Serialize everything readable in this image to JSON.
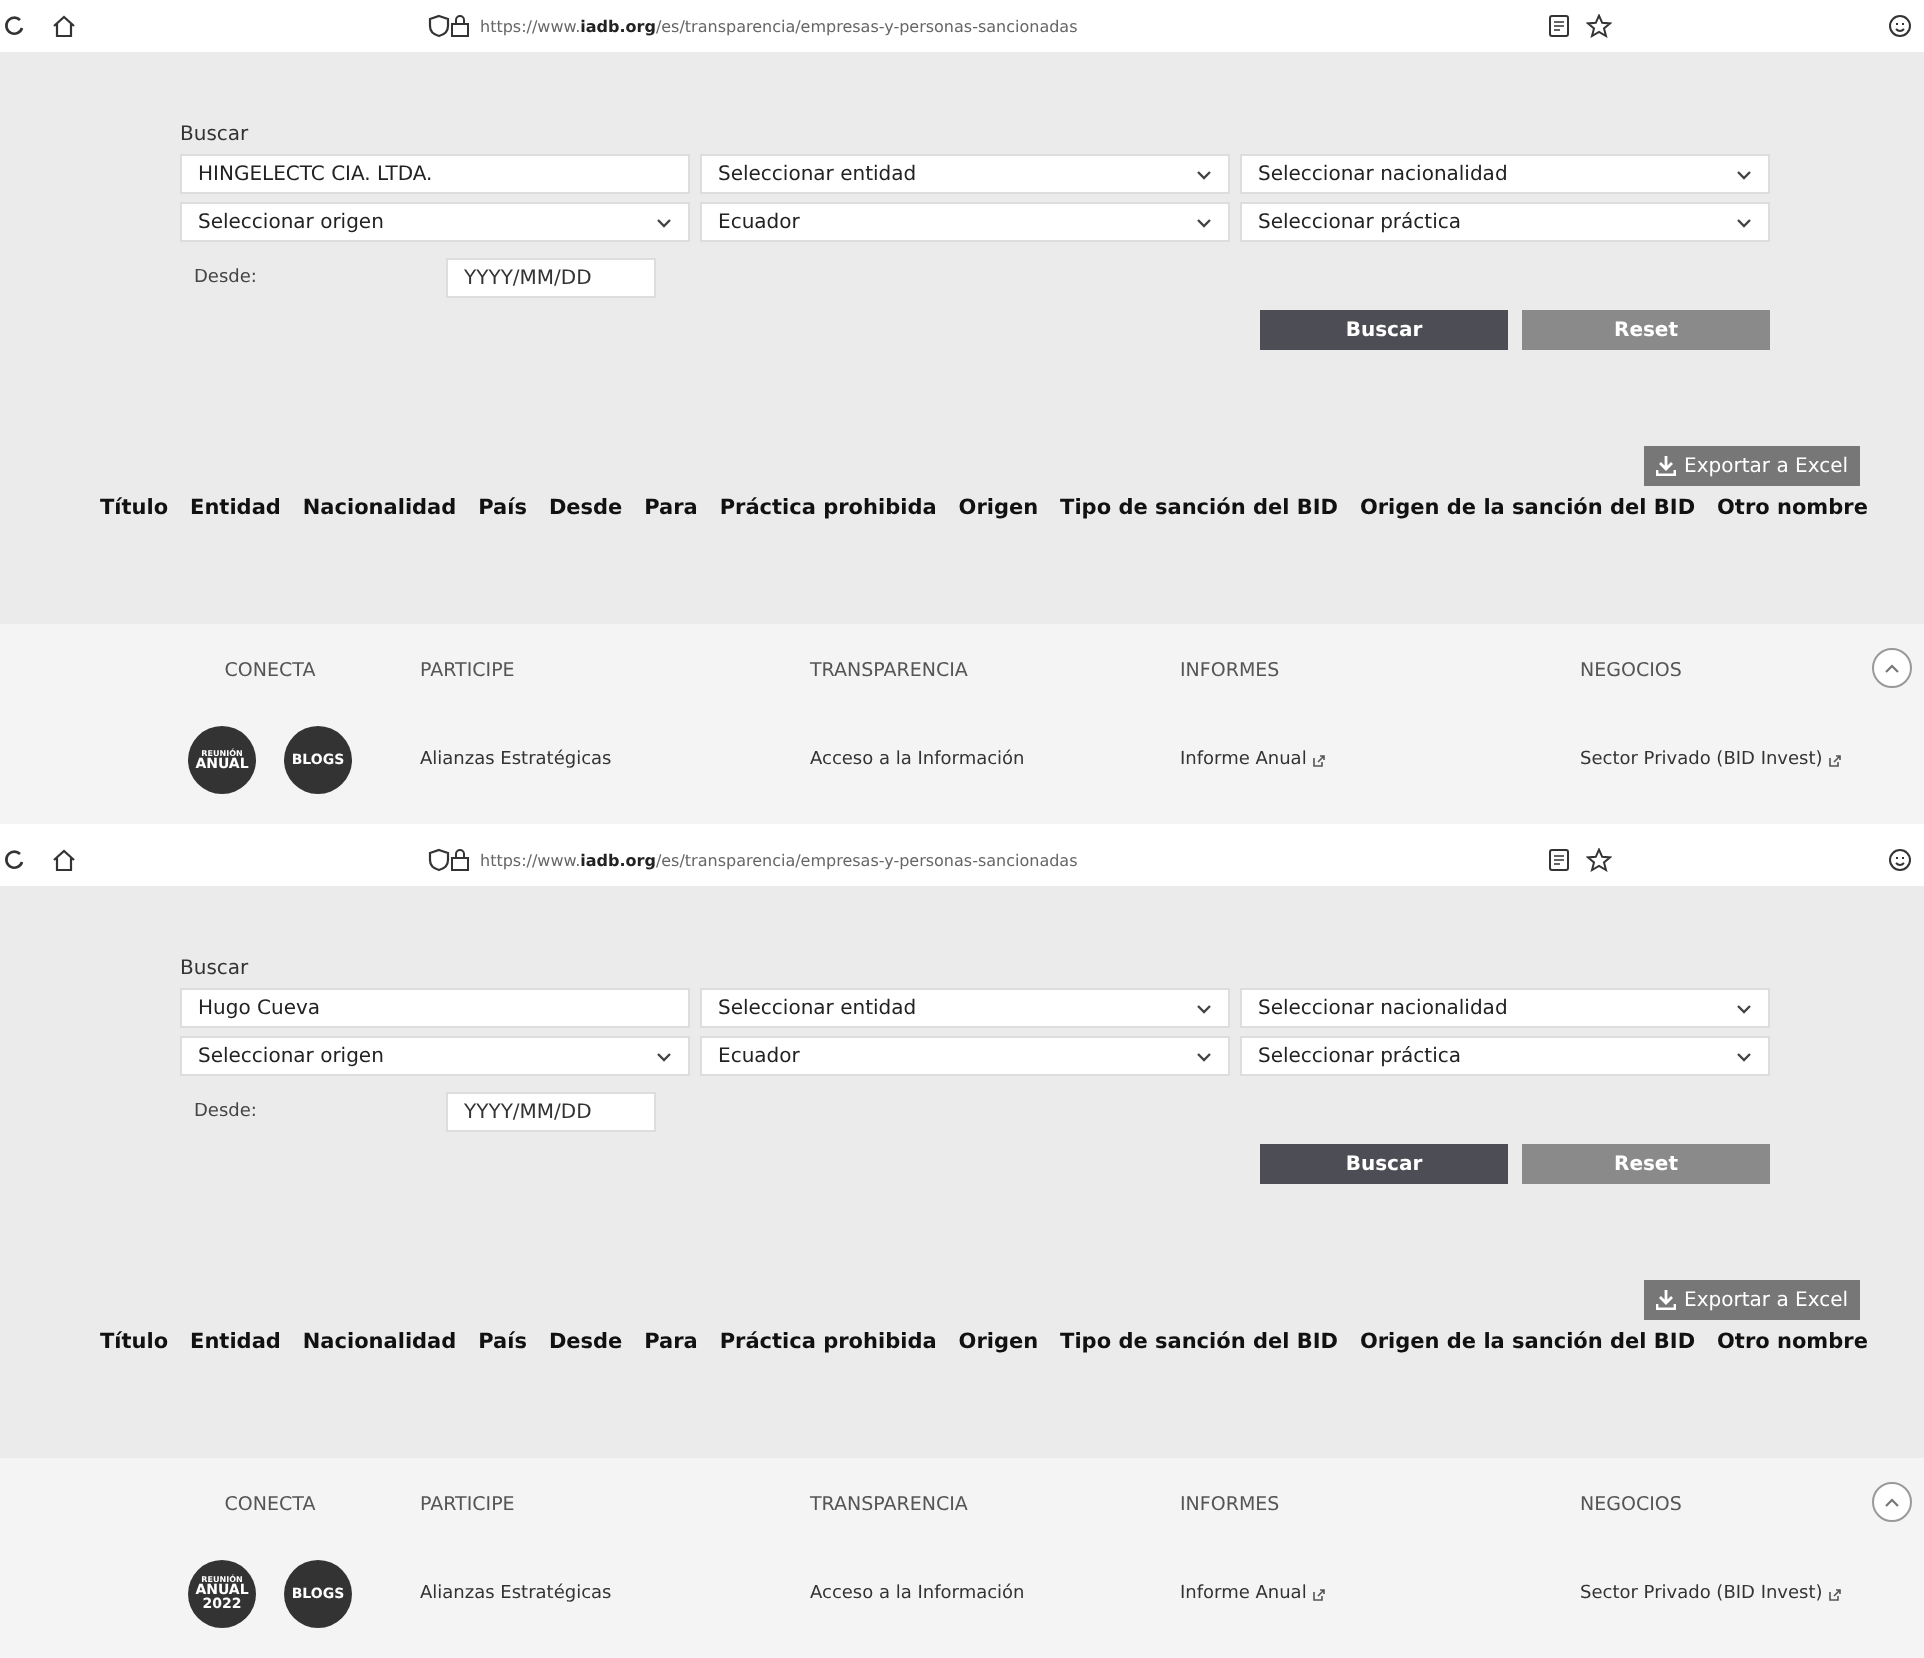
{
  "panels": [
    {
      "browser": {
        "url": "https://www.**iadb.org**/es/transparencia/empresas-y-personas-sancionadas"
      },
      "search": {
        "label": "Buscar",
        "value": "HINGELECTC CIA. LTDA."
      },
      "selects": [
        "Seleccionar entidad",
        "Seleccionar nacionalidad",
        "Seleccionar origen",
        "Ecuador",
        "Seleccionar práctica"
      ],
      "date": {
        "label": "Desde:",
        "placeholder": "YYYY/MM/DD"
      },
      "buttons": [
        {
          "label": "Buscar",
          "kind": "primary"
        },
        {
          "label": "Reset",
          "kind": "secondary"
        }
      ],
      "export": "Exportar a Excel",
      "columns": [
        "Título",
        "Entidad",
        "Nacionalidad",
        "País",
        "Desde",
        "Para",
        "Práctica prohibida",
        "Origen",
        "Tipo de sanción del BID",
        "Origen de la sanción del BID",
        "Otro nombre"
      ],
      "footer": {
        "headings": [
          "CONECTA",
          "PARTICIPE",
          "TRANSPARENCIA",
          "INFORMES",
          "NEGOCIOS"
        ],
        "badges": [
          {
            "lines": [
              "REUNIÓN",
              "ANUAL"
            ]
          },
          {
            "lines": [
              "BLOGS"
            ]
          }
        ],
        "links": [
          {
            "label": "Alianzas Estratégicas",
            "external": false
          },
          {
            "label": "Acceso a la Información",
            "external": false
          },
          {
            "label": "Informe Anual",
            "external": true
          },
          {
            "label": "Sector Privado (BID Invest)",
            "external": true
          }
        ]
      }
    },
    {
      "browser": {
        "url": "https://www.**iadb.org**/es/transparencia/empresas-y-personas-sancionadas"
      },
      "search": {
        "label": "Buscar",
        "value": "Hugo Cueva"
      },
      "selects": [
        "Seleccionar entidad",
        "Seleccionar nacionalidad",
        "Seleccionar origen",
        "Ecuador",
        "Seleccionar práctica"
      ],
      "date": {
        "label": "Desde:",
        "placeholder": "YYYY/MM/DD"
      },
      "buttons": [
        {
          "label": "Buscar",
          "kind": "primary"
        },
        {
          "label": "Reset",
          "kind": "secondary"
        }
      ],
      "export": "Exportar a Excel",
      "columns": [
        "Título",
        "Entidad",
        "Nacionalidad",
        "País",
        "Desde",
        "Para",
        "Práctica prohibida",
        "Origen",
        "Tipo de sanción del BID",
        "Origen de la sanción del BID",
        "Otro nombre"
      ],
      "footer": {
        "headings": [
          "CONECTA",
          "PARTICIPE",
          "TRANSPARENCIA",
          "INFORMES",
          "NEGOCIOS"
        ],
        "badges": [
          {
            "lines": [
              "REUNIÓN",
              "ANUAL",
              "2022"
            ]
          },
          {
            "lines": [
              "BLOGS"
            ]
          }
        ],
        "links": [
          {
            "label": "Alianzas Estratégicas",
            "external": false
          },
          {
            "label": "Acceso a la Información",
            "external": false
          },
          {
            "label": "Informe Anual",
            "external": true
          },
          {
            "label": "Sector Privado (BID Invest)",
            "external": true
          }
        ]
      }
    }
  ]
}
